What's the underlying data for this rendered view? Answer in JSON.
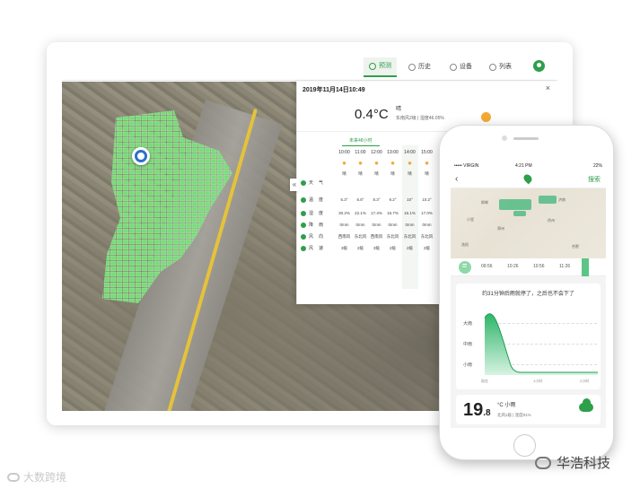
{
  "desktop": {
    "nav": [
      {
        "label": "预测",
        "active": true
      },
      {
        "label": "历史",
        "active": false
      },
      {
        "label": "设备",
        "active": false
      },
      {
        "label": "列表",
        "active": false
      }
    ],
    "popup": {
      "datetime": "2019年11月14日10:49",
      "close": "×",
      "temperature": "0.4°C",
      "condition": "晴",
      "wind_humidity": "东南风2级 | 湿度46.05%",
      "tab": "未来48小时",
      "collapse_arrow": "«",
      "times": [
        "10:00",
        "11:00",
        "12:00",
        "13:00",
        "14:00",
        "15:00"
      ],
      "rows": [
        {
          "label": "天气",
          "values": [
            "晴",
            "晴",
            "晴",
            "晴",
            "晴",
            "晴"
          ]
        },
        {
          "label": "温度",
          "values": [
            "5.3°",
            "6.8°",
            "8.3°",
            "9.2°",
            "10°",
            "10.2°"
          ]
        },
        {
          "label": "湿度",
          "values": [
            "30.2%",
            "22.1%",
            "17.4%",
            "16.7%",
            "16.1%",
            "17.0%"
          ]
        },
        {
          "label": "降雨",
          "values": [
            "0mm",
            "0mm",
            "0mm",
            "0mm",
            "0mm",
            "0mm"
          ]
        },
        {
          "label": "风向",
          "values": [
            "西南风",
            "东北风",
            "西南风",
            "东北风",
            "东北风",
            "东北风"
          ]
        },
        {
          "label": "风速",
          "values": [
            "3级",
            "2级",
            "3级",
            "2级",
            "2级",
            "2级"
          ]
        }
      ]
    }
  },
  "phone": {
    "status": {
      "carrier": "••••• VIRGIN",
      "time": "4:21 PM",
      "battery": "22%"
    },
    "nav": {
      "back": "‹",
      "search": "搜索"
    },
    "map_cities": [
      "邯郸",
      "济南",
      "郑州",
      "合肥",
      "徐州",
      "小里",
      "洛阳"
    ],
    "timeline": [
      "09:56",
      "10:26",
      "10:56",
      "11:26"
    ],
    "forecast_text": "约31分钟后雨就停了，之后也不会下了",
    "levels": [
      "大雨",
      "中雨",
      "小雨"
    ],
    "x_ticks": [
      "现在",
      "1小时",
      "2小时"
    ],
    "temp_int": "19",
    "temp_dec": ".8",
    "unit_cond": "°C 小雨",
    "wind_humidity": "北风1级 | 湿度91%"
  },
  "watermark": {
    "left": "大数跨境",
    "right": "华浩科技"
  },
  "colors": {
    "accent": "#2e9f4a",
    "sun": "#f3a933",
    "road": "#e5c23a"
  }
}
